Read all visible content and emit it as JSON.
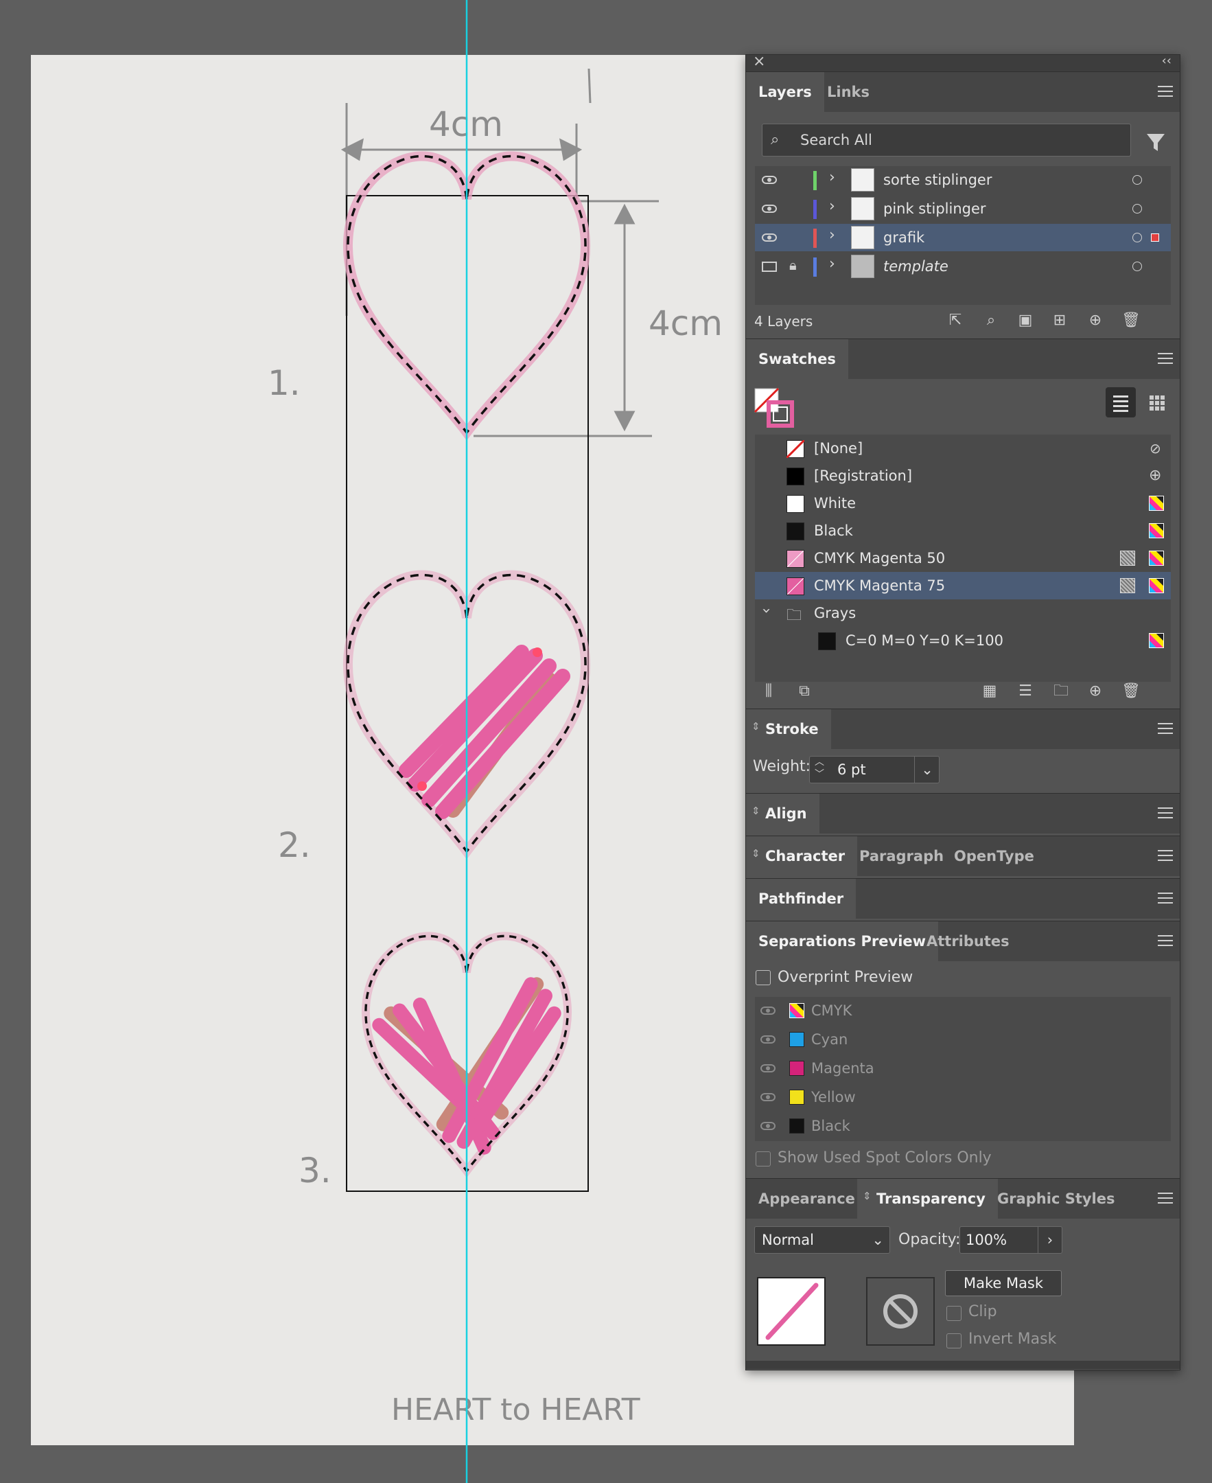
{
  "canvas": {
    "labels": [
      "4cm",
      "4cm",
      "1.",
      "2.",
      "3."
    ],
    "caption": "HEART to HEART"
  },
  "layers_panel": {
    "tabs": [
      "Layers",
      "Links"
    ],
    "search_placeholder": "Search All",
    "layers": [
      {
        "name": "sorte stiplinger",
        "color": "#6fd26a",
        "visible": true,
        "locked": false,
        "selected": false
      },
      {
        "name": "pink stiplinger",
        "color": "#5b57d8",
        "visible": true,
        "locked": false,
        "selected": false
      },
      {
        "name": "grafik",
        "color": "#e05555",
        "visible": true,
        "locked": false,
        "selected": true
      },
      {
        "name": "template",
        "color": "#5a7de0",
        "visible": false,
        "locked": true,
        "selected": false
      }
    ],
    "count_label": "4 Layers"
  },
  "swatches_panel": {
    "tab": "Swatches",
    "items": [
      {
        "name": "[None]",
        "color": "none"
      },
      {
        "name": "[Registration]",
        "color": "#000000"
      },
      {
        "name": "White",
        "color": "#ffffff"
      },
      {
        "name": "Black",
        "color": "#111111"
      },
      {
        "name": "CMYK Magenta 50",
        "color": "#ee9bc4",
        "selected": false
      },
      {
        "name": "CMYK Magenta 75",
        "color": "#e35fa0",
        "selected": true
      }
    ],
    "group": {
      "name": "Grays",
      "items": [
        {
          "name": "C=0 M=0 Y=0 K=100",
          "color": "#111111"
        }
      ]
    }
  },
  "stroke_panel": {
    "tab": "Stroke",
    "weight_label": "Weight:",
    "weight_value": "6 pt"
  },
  "align_panel": {
    "tab": "Align"
  },
  "character_panel": {
    "tabs": [
      "Character",
      "Paragraph",
      "OpenType"
    ]
  },
  "pathfinder_panel": {
    "tab": "Pathfinder"
  },
  "separations_panel": {
    "tabs": [
      "Separations Preview",
      "Attributes"
    ],
    "overprint_label": "Overprint Preview",
    "plates": [
      {
        "name": "CMYK",
        "color": "cmyk"
      },
      {
        "name": "Cyan",
        "color": "#1ea0e6"
      },
      {
        "name": "Magenta",
        "color": "#d4237a"
      },
      {
        "name": "Yellow",
        "color": "#f2e11b"
      },
      {
        "name": "Black",
        "color": "#111111"
      }
    ],
    "spot_label": "Show Used Spot Colors Only"
  },
  "transparency_panel": {
    "tabs": [
      "Appearance",
      "Transparency",
      "Graphic Styles"
    ],
    "blend_mode": "Normal",
    "opacity_label": "Opacity:",
    "opacity_value": "100%",
    "make_mask": "Make Mask",
    "clip_label": "Clip",
    "invert_label": "Invert Mask"
  }
}
